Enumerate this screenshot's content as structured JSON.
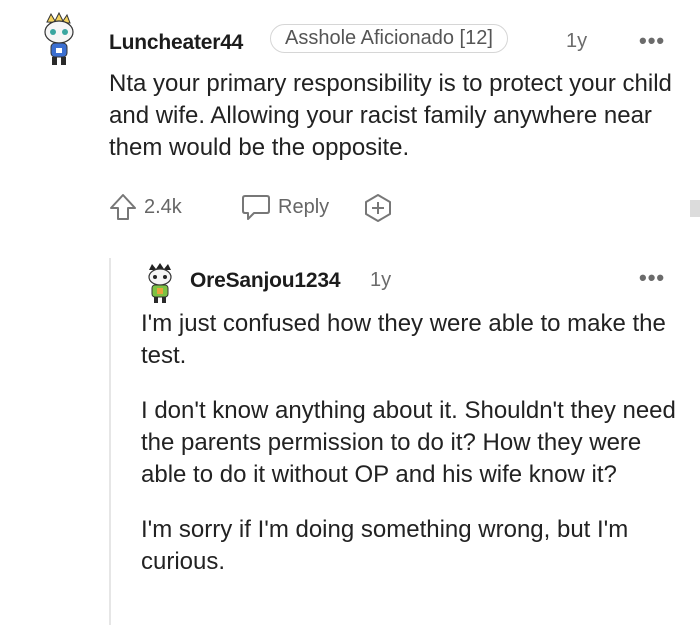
{
  "comment": {
    "username": "Luncheater44",
    "flair": "Asshole Aficionado [12]",
    "age": "1y",
    "more": "•••",
    "text": "Nta your primary responsibility is to protect your child and wife. Allowing your racist family anywhere near them would be the opposite.",
    "upvotes": "2.4k",
    "reply_label": "Reply"
  },
  "reply": {
    "username": "OreSanjou1234",
    "age": "1y",
    "more": "•••",
    "paragraphs": [
      "I'm just confused how they were able to make the test.",
      "I don't know anything about it. Shouldn't they need the parents permission to do it? How they were able to do it without OP and his wife know it?",
      "I'm sorry if I'm doing something wrong, but I'm curious."
    ]
  },
  "icons": {
    "upvote": "arrow-up-outline-icon",
    "reply": "speech-bubble-icon",
    "award": "award-plus-icon",
    "more": "more-horizontal-icon"
  }
}
